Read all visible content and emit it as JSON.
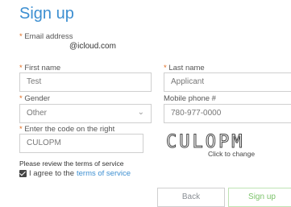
{
  "form": {
    "title": "Sign up",
    "required_marker": "*",
    "email": {
      "label": "Email address",
      "value": "@icloud.com"
    },
    "first_name": {
      "label": "First name",
      "value": "Test"
    },
    "last_name": {
      "label": "Last name",
      "value": "Applicant"
    },
    "gender": {
      "label": "Gender",
      "value": "Other"
    },
    "mobile": {
      "label": "Mobile phone #",
      "value": "780-977-0000"
    },
    "captcha": {
      "label": "Enter the code on the right",
      "value": "CULOPM",
      "image_text": "CULOPM",
      "hint": "Click to change"
    },
    "terms": {
      "review_text": "Please review the terms of service",
      "agree_text": "I agree to the",
      "link_text": "terms of service",
      "checked": true
    },
    "buttons": {
      "back": "Back",
      "signup": "Sign up"
    },
    "colors": {
      "accent": "#3d8fd1",
      "required": "#e06a1b",
      "signup": "#7cc36b"
    }
  }
}
